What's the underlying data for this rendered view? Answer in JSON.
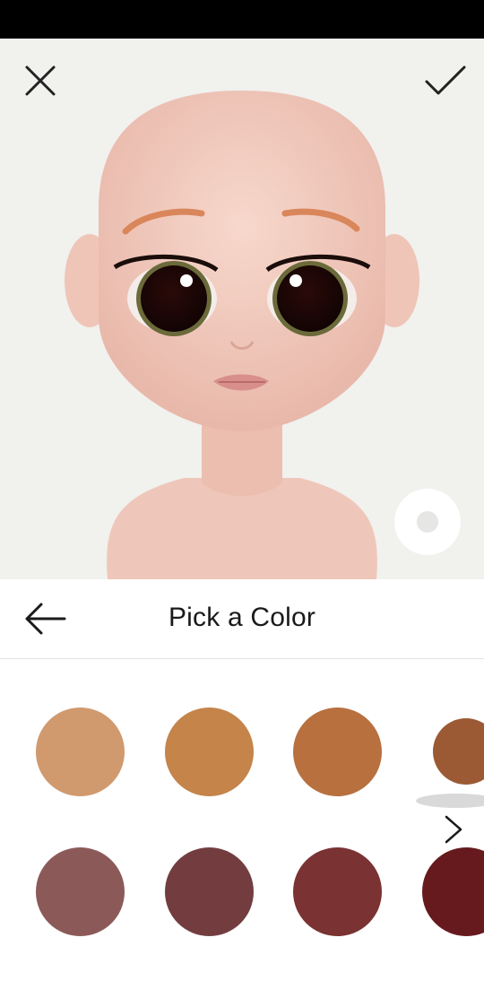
{
  "header": {
    "title": "Pick a Color"
  },
  "icons": {
    "close": "close-icon",
    "confirm": "checkmark-icon",
    "back": "arrow-left-icon",
    "next": "chevron-right-icon",
    "zoom": "circle-toggle-icon"
  },
  "palette": {
    "row1": [
      "#d09a6e",
      "#c4844a",
      "#b8703f",
      "#9b5a34"
    ],
    "row2": [
      "#8b5a58",
      "#733d3f",
      "#7a3232",
      "#661a1d"
    ]
  }
}
